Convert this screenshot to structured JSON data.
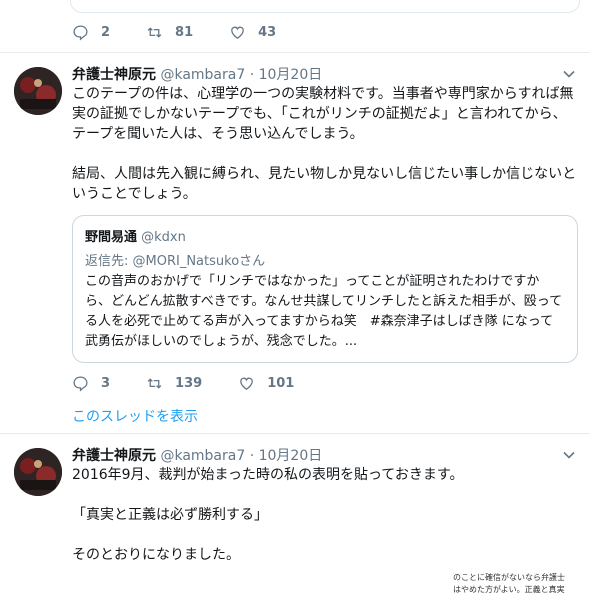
{
  "top_tweet": {
    "replies": "2",
    "retweets": "81",
    "likes": "43"
  },
  "tweet1": {
    "name": "弁護士神原元",
    "handle": "@kambara7",
    "separator": "·",
    "time": "10月20日",
    "paragraph1": "このテープの件は、心理学の一つの実験材料です。当事者や専門家からすれば無実の証拠でしかないテープでも、「これがリンチの証拠だよ」と言われてから、テープを聞いた人は、そう思い込んでしまう。",
    "paragraph2": "結局、人間は先入観に縛られ、見たい物しか見ないし信じたい事しか信じないということでしょう。",
    "quote": {
      "name": "野間易通",
      "handle": "@kdxn",
      "reply_prefix": "返信先: ",
      "reply_target": "@MORI_Natsukoさん",
      "text": "この音声のおかげで「リンチではなかった」ってことが証明されたわけですから、どんどん拡散すべきです。なんせ共謀してリンチしたと訴えた相手が、殴ってる人を必死で止めてる声が入ってますからね笑　#森奈津子はしばき隊 になって武勇伝がほしいのでしょうが、残念でした。..."
    },
    "replies": "3",
    "retweets": "139",
    "likes": "101",
    "thread_link": "このスレッドを表示"
  },
  "tweet2": {
    "name": "弁護士神原元",
    "handle": "@kambara7",
    "separator": "·",
    "time": "10月20日",
    "line1": "2016年9月、裁判が始まった時の私の表明を貼っておきます。",
    "line2": "「真実と正義は必ず勝利する」",
    "line3": "そのとおりになりました。"
  },
  "watermark": {
    "line1": "のことに確信がないなら弁護士",
    "line2": "はやめた方がよい。正義と真実"
  },
  "colors": {
    "accent": "#1da1f2",
    "muted": "#657786",
    "border": "#e6ecf0"
  }
}
